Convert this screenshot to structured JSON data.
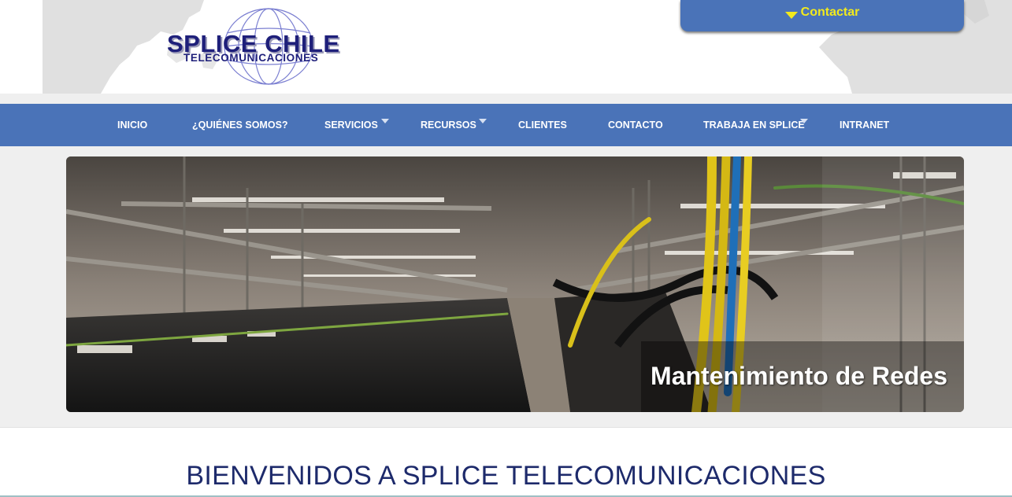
{
  "brand": {
    "name": "SPLICE CHILE",
    "tagline": "TELECOMUNICACIONES"
  },
  "header": {
    "contact_label": "Contactar"
  },
  "nav": {
    "items": [
      {
        "label": "INICIO",
        "has_submenu": false
      },
      {
        "label": "¿QUIÉNES SOMOS?",
        "has_submenu": false
      },
      {
        "label": "SERVICIOS",
        "has_submenu": true
      },
      {
        "label": "RECURSOS",
        "has_submenu": true
      },
      {
        "label": "CLIENTES",
        "has_submenu": false
      },
      {
        "label": "CONTACTO",
        "has_submenu": false
      },
      {
        "label": "TRABAJA EN SPLICE",
        "has_submenu": true
      },
      {
        "label": "INTRANET",
        "has_submenu": false
      }
    ]
  },
  "slider": {
    "caption": "Mantenimiento de Redes"
  },
  "main": {
    "heading": "BIENVENIDOS A SPLICE TELECOMUNICACIONES"
  },
  "colors": {
    "nav_bg": "#4a73b8",
    "contact_text": "#f2ea1c",
    "brand_navy": "#1e1f7a",
    "heading": "#1d2a6b"
  }
}
